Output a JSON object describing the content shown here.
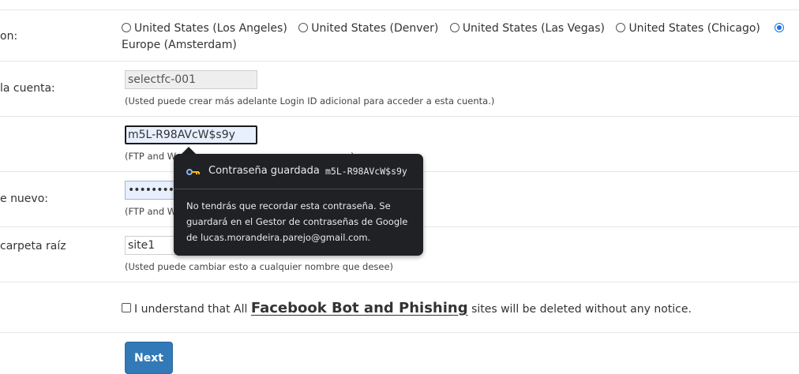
{
  "location": {
    "label": "on:",
    "options": [
      {
        "label": "United States (Los Angeles)",
        "selected": false
      },
      {
        "label": "United States (Denver)",
        "selected": false
      },
      {
        "label": "United States (Las Vegas)",
        "selected": false
      },
      {
        "label": "United States (Chicago)",
        "selected": false
      },
      {
        "label": "Europe (Amsterdam)",
        "selected": true
      }
    ]
  },
  "account": {
    "label": "la cuenta:",
    "value": "selectfc-001",
    "help": "(Usted puede crear más adelante Login ID adicional para acceder a esta cuenta.)"
  },
  "password": {
    "value": "m5L-R98AVcW$s9y",
    "help_visible": "(FTP and W",
    "help_end": "...)"
  },
  "password_repeat": {
    "label": "e nuevo:",
    "value": "•••••••••••••••",
    "help_visible": "(FTP and W"
  },
  "root_folder": {
    "label": "carpeta raíz",
    "value": "site1",
    "help": "(Usted puede cambiar esto a cualquier nombre que desee)"
  },
  "terms": {
    "prefix": "I understand that All",
    "link": "Facebook Bot and Phishing",
    "suffix": "sites will be deleted without any notice.",
    "checked": false
  },
  "next_button": "Next",
  "password_popup": {
    "title": "Contraseña guardada",
    "password": "m5L-R98AVcW$s9y",
    "body": "No tendrás que recordar esta contraseña. Se guardará en el Gestor de contraseñas de Google de lucas.morandeira.parejo@gmail.com.",
    "icon": "key-icon",
    "icon_colors": [
      "#8ab4f8",
      "#fbbc04"
    ]
  },
  "colors": {
    "primary_button": "#3279b7",
    "radio_selected": "#1a73e8",
    "popup_bg": "#202124"
  }
}
